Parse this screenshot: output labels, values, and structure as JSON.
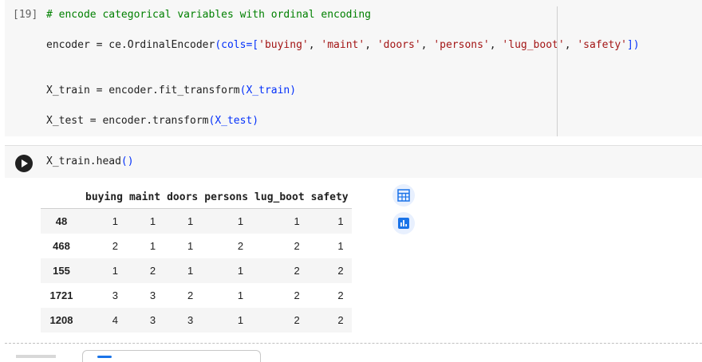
{
  "cell1": {
    "exec_count": "[19]",
    "comment": "# encode categorical variables with ordinal encoding",
    "encoder_pre": "encoder = ce.OrdinalEncoder",
    "encoder_open": "(cols=[",
    "cols": [
      "'buying'",
      "'maint'",
      "'doors'",
      "'persons'",
      "'lug_boot'",
      "'safety'"
    ],
    "encoder_close": "])",
    "xtrain_pre": "X_train = encoder.fit_transform",
    "xtrain_arg": "(X_train)",
    "xtest_pre": "X_test = encoder.transform",
    "xtest_arg": "(X_test)"
  },
  "cell2": {
    "code_pre": "X_train.head",
    "code_paren": "()"
  },
  "output": {
    "columns": [
      "",
      "buying",
      "maint",
      "doors",
      "persons",
      "lug_boot",
      "safety"
    ],
    "rows": [
      [
        "48",
        "1",
        "1",
        "1",
        "1",
        "1",
        "1"
      ],
      [
        "468",
        "2",
        "1",
        "1",
        "2",
        "2",
        "1"
      ],
      [
        "155",
        "1",
        "2",
        "1",
        "1",
        "2",
        "2"
      ],
      [
        "1721",
        "3",
        "3",
        "2",
        "1",
        "2",
        "2"
      ],
      [
        "1208",
        "4",
        "3",
        "3",
        "1",
        "2",
        "2"
      ]
    ]
  },
  "icons": {
    "table": "table-grid-icon",
    "chart": "bar-chart-icon",
    "accent": "#1a73e8"
  }
}
